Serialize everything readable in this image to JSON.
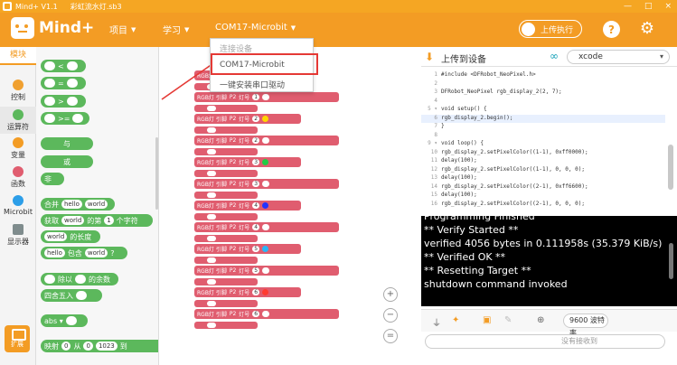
{
  "window": {
    "app_name": "Mind+ V1.1",
    "file_name": "彩虹流水灯.sb3",
    "controls": [
      "—",
      "□",
      "×"
    ]
  },
  "header": {
    "brand": "Mind+",
    "menus": [
      {
        "label": "项目"
      },
      {
        "label": "学习"
      },
      {
        "label": "COM17-Microbit"
      }
    ],
    "upload_toggle": "上传执行",
    "help": "?"
  },
  "dropdown": {
    "items": [
      "连接设备",
      "COM17-Microbit",
      "一键安装串口驱动"
    ]
  },
  "sidebar": {
    "modules_tab": "模块",
    "categories": [
      {
        "label": "控制",
        "color": "#f0a030"
      },
      {
        "label": "运算符",
        "color": "#5cb85c"
      },
      {
        "label": "变量",
        "color": "#f39c24"
      },
      {
        "label": "函数",
        "color": "#e05d6f"
      },
      {
        "label": "Microbit",
        "color": "#2c9ee8"
      },
      {
        "label": "显示器",
        "color": "#7f8c8d"
      }
    ],
    "ext_label": "扩展"
  },
  "palette": {
    "ge_label": ">=",
    "and": "与",
    "or": "或",
    "not": "非",
    "join": {
      "prefix": "合并",
      "a": "hello",
      "b": "world"
    },
    "letter": {
      "prefix": "获取",
      "word": "world",
      "mid": "的第",
      "n": "1",
      "suffix": "个字符"
    },
    "length": {
      "word": "world",
      "suffix": "的长度"
    },
    "contains": {
      "a": "hello",
      "mid": "包含",
      "b": "world",
      "suffix": "?"
    },
    "mod": {
      "prefix": "除以",
      "suffix": "的余数"
    },
    "round": "四舍五入",
    "abs": "abs ▾",
    "map": {
      "prefix": "映射",
      "a": "0",
      "from": "从",
      "b": "0",
      "c": "1023",
      "to": "到"
    }
  },
  "workspace": {
    "block_text": "RGB灯 引脚",
    "pin": "P2",
    "led_label": "灯号",
    "index_values": [
      "1",
      "1",
      "2",
      "2",
      "3",
      "3",
      "4",
      "4",
      "5",
      "5",
      "6",
      "6"
    ],
    "swatch_colors": [
      "#ff3b30",
      "#ffd500",
      "#22cc44",
      "#2233ff",
      "#29b6f6"
    ],
    "zoom_in": "+",
    "zoom_out": "−",
    "zoom_reset": "="
  },
  "code_panel": {
    "title": "上传到设备",
    "language": "xcode",
    "lines": [
      {
        "n": "1",
        "text": "#include <DFRobot_NeoPixel.h>"
      },
      {
        "n": "2",
        "text": ""
      },
      {
        "n": "3",
        "text": "DFRobot_NeoPixel  rgb_display_2(2, 7);"
      },
      {
        "n": "4",
        "text": ""
      },
      {
        "n": "5 ▾",
        "text": "void setup() {"
      },
      {
        "n": "6",
        "text": "    rgb_display_2.begin();"
      },
      {
        "n": "7",
        "text": "}"
      },
      {
        "n": "8",
        "text": ""
      },
      {
        "n": "9 ▾",
        "text": "void loop() {"
      },
      {
        "n": "10",
        "text": "    rgb_display_2.setPixelColor((1-1), 0xff0000);"
      },
      {
        "n": "11",
        "text": "    delay(100);"
      },
      {
        "n": "12",
        "text": "    rgb_display_2.setPixelColor((1-1), 0, 0, 0);"
      },
      {
        "n": "13",
        "text": "    delay(100);"
      },
      {
        "n": "14",
        "text": "    rgb_display_2.setPixelColor((2-1), 0xff6600);"
      },
      {
        "n": "15",
        "text": "    delay(100);"
      },
      {
        "n": "16",
        "text": "    rgb_display_2.setPixelColor((2-1), 0, 0, 0);"
      }
    ]
  },
  "console": {
    "lines": [
      "Programming Finished",
      "** Verify Started **",
      "verified 4056 bytes in 0.111958s (35.379 KiB/s)",
      "** Verified OK **",
      "** Resetting Target **",
      "shutdown command invoked"
    ]
  },
  "serial": {
    "baud": "9600 波特率",
    "placeholder": "没有接收到"
  }
}
